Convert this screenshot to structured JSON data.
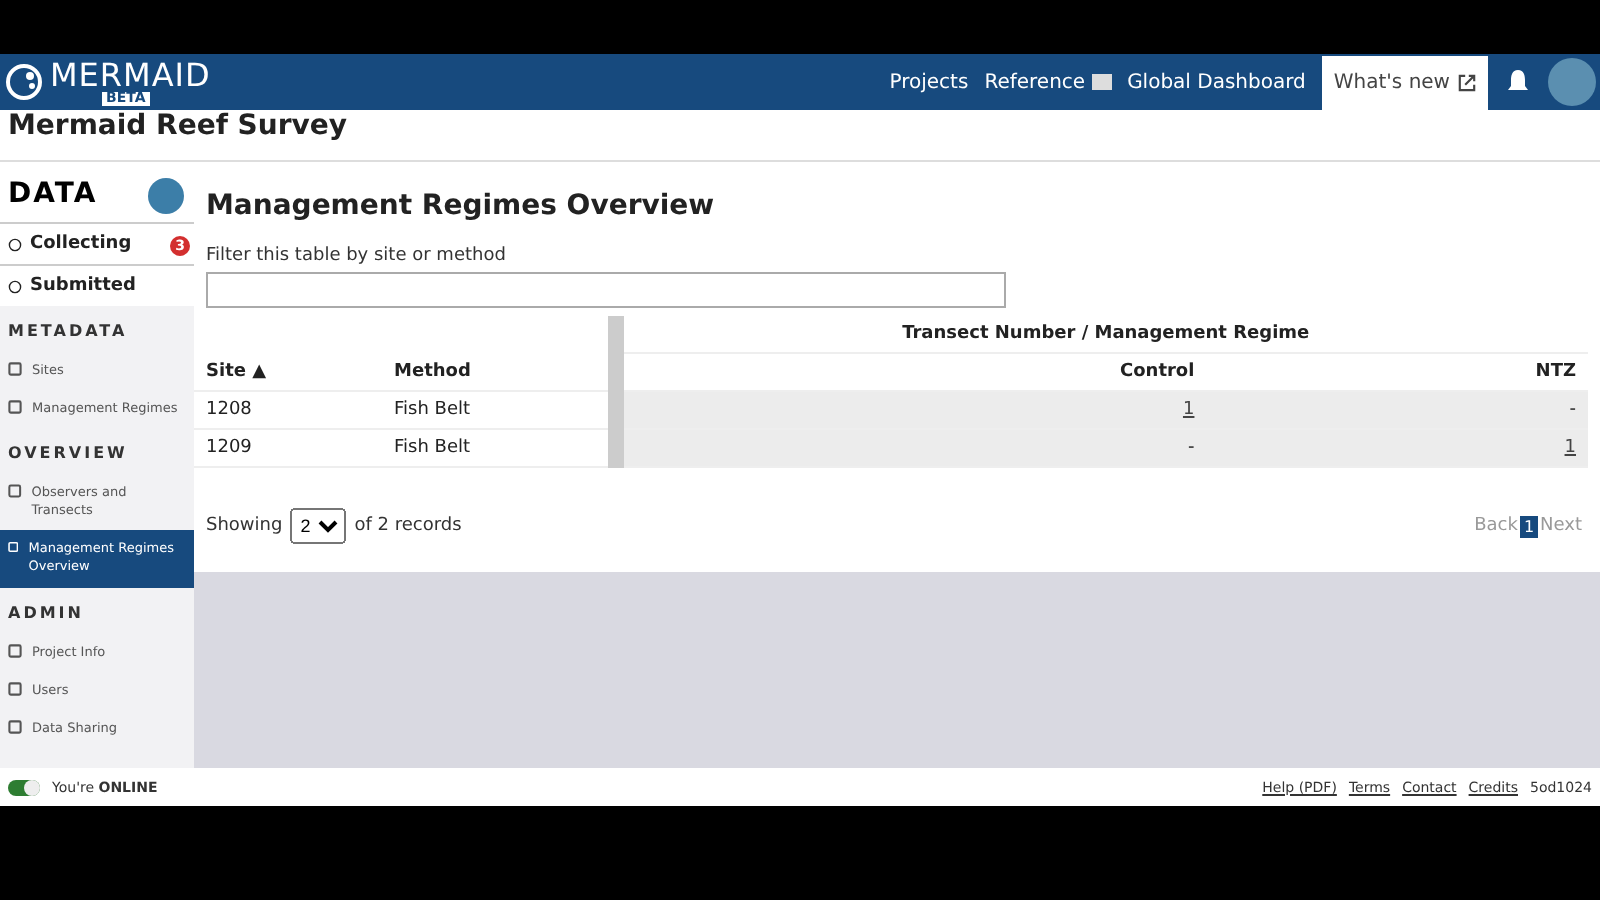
{
  "header": {
    "logo": "MERMAID",
    "badge": "BETA",
    "nav": [
      "Projects",
      "Reference",
      "Global Dashboard"
    ],
    "whats_new": "What's new"
  },
  "project_title": "Mermaid Reef Survey",
  "sidebar": {
    "title": "DATA",
    "items": [
      {
        "kind": "tab",
        "label": "Collecting",
        "selected": false,
        "badge": "3"
      },
      {
        "kind": "tab",
        "label": "Submitted",
        "selected": false
      },
      {
        "kind": "section",
        "label": "METADATA"
      },
      {
        "kind": "item",
        "label": "Sites",
        "selected": false
      },
      {
        "kind": "item",
        "label": "Management Regimes",
        "selected": false
      },
      {
        "kind": "section",
        "label": "OVERVIEW"
      },
      {
        "kind": "item",
        "label": "Observers and Transects",
        "selected": false
      },
      {
        "kind": "item",
        "label": "Management Regimes Overview",
        "selected": true
      },
      {
        "kind": "section",
        "label": "ADMIN"
      },
      {
        "kind": "item",
        "label": "Project Info",
        "selected": false
      },
      {
        "kind": "item",
        "label": "Users",
        "selected": false
      },
      {
        "kind": "item",
        "label": "Data Sharing",
        "selected": false
      }
    ]
  },
  "page": {
    "title": "Management Regimes Overview",
    "filter_label": "Filter this table by site or method"
  },
  "table": {
    "group_header": "Transect Number / Management Regime",
    "columns": [
      {
        "label": "Site",
        "sort": "▲"
      },
      {
        "label": "Method"
      },
      {
        "label": "Control"
      },
      {
        "label": "NTZ"
      }
    ],
    "rows": [
      [
        "1208",
        "Fish Belt",
        "1",
        "-"
      ],
      [
        "1209",
        "Fish Belt",
        "-",
        "1"
      ]
    ]
  },
  "pagination": {
    "showing": "Showing",
    "page_size": "2",
    "of_records": "of 2 records",
    "back": "Back",
    "next": "Next",
    "back_disabled": true,
    "next_disabled": true,
    "pages": [
      {
        "label": "1",
        "selected": true
      }
    ]
  },
  "footer": {
    "online": true,
    "status": "You're **ONLINE**",
    "links": [
      "Help (PDF)",
      "Terms",
      "Contact",
      "Credits"
    ],
    "version": "5od1024"
  }
}
